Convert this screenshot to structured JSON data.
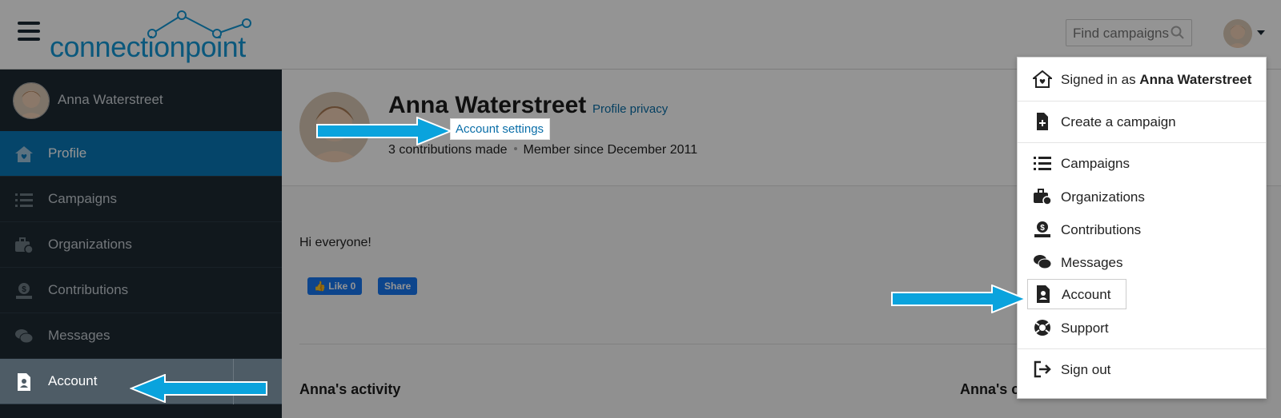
{
  "header": {
    "logo_text": "connectionpoint",
    "search_placeholder": "Find campaigns"
  },
  "sidebar": {
    "user_name": "Anna Waterstreet",
    "items": [
      {
        "label": "Profile",
        "icon": "home-heart-icon"
      },
      {
        "label": "Campaigns",
        "icon": "list-icon"
      },
      {
        "label": "Organizations",
        "icon": "briefcase-clock-icon"
      },
      {
        "label": "Contributions",
        "icon": "dollar-tray-icon"
      },
      {
        "label": "Messages",
        "icon": "chat-bubbles-icon"
      },
      {
        "label": "Account",
        "icon": "id-badge-icon"
      }
    ]
  },
  "profile": {
    "name": "Anna Waterstreet",
    "privacy_link": "Profile privacy",
    "settings_link": "Account settings",
    "contributions": "3 contributions made",
    "member_since": "Member since December 2011",
    "bio": "Hi everyone!",
    "like_label": "Like 0",
    "share_label": "Share",
    "activity_heading": "Anna's activity",
    "campaigns_heading": "Anna's campaigns"
  },
  "dropdown": {
    "signed_in_prefix": "Signed in as ",
    "signed_in_name": "Anna Waterstreet",
    "create": "Create a campaign",
    "items": [
      "Campaigns",
      "Organizations",
      "Contributions",
      "Messages",
      "Account",
      "Support"
    ],
    "signout": "Sign out"
  },
  "colors": {
    "brand": "#1398d6",
    "sidebar_bg": "#1e2a33",
    "active": "#0a78b7",
    "arrow": "#0aa3dd"
  }
}
